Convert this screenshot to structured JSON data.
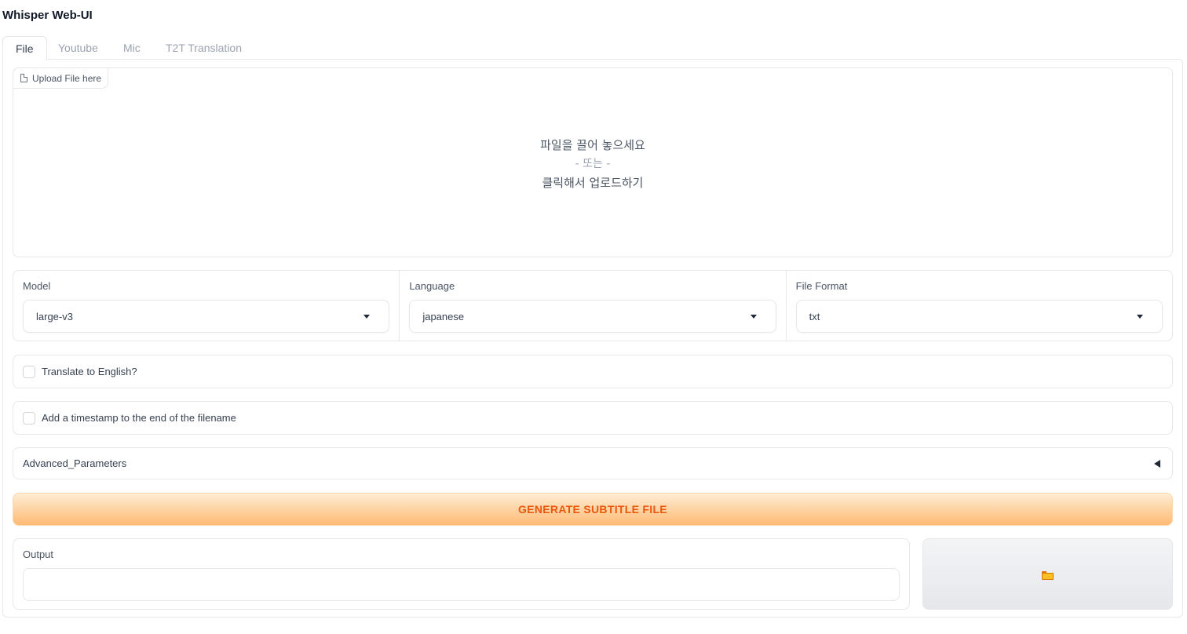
{
  "app": {
    "title": "Whisper Web-UI"
  },
  "tabs": [
    {
      "label": "File",
      "active": true
    },
    {
      "label": "Youtube",
      "active": false
    },
    {
      "label": "Mic",
      "active": false
    },
    {
      "label": "T2T Translation",
      "active": false
    }
  ],
  "upload": {
    "chip_label": "Upload File here",
    "drop_text": "파일을 끌어 놓으세요",
    "or_text": "- 또는 -",
    "click_text": "클릭해서 업로드하기"
  },
  "model": {
    "label": "Model",
    "value": "large-v3"
  },
  "language": {
    "label": "Language",
    "value": "japanese"
  },
  "file_format": {
    "label": "File Format",
    "value": "txt"
  },
  "options": {
    "translate_label": "Translate to English?",
    "translate_checked": false,
    "timestamp_label": "Add a timestamp to the end of the filename",
    "timestamp_checked": false
  },
  "advanced": {
    "label": "Advanced_Parameters",
    "expanded": false
  },
  "generate": {
    "label": "GENERATE SUBTITLE FILE"
  },
  "output": {
    "label": "Output",
    "value": ""
  },
  "folder_button": {
    "icon": "folder-icon"
  },
  "colors": {
    "accent_text": "#ea580c",
    "accent_gradient_from": "#ffedd5",
    "accent_gradient_to": "#fdba74",
    "border": "#e5e7eb"
  }
}
